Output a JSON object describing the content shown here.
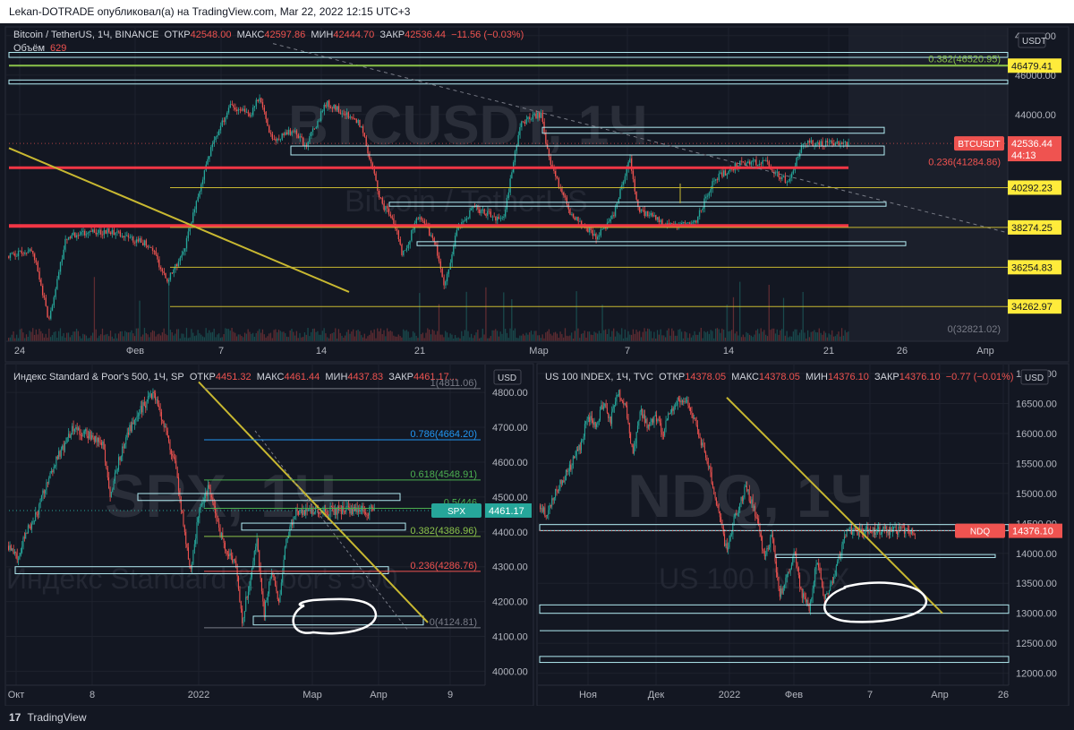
{
  "header": {
    "publish_line": "Lekan-DOTRADE опубликовал(а) на TradingView.com, Mar 22, 2022 12:15 UTC+3"
  },
  "footer": {
    "logo_mark": "17",
    "logo_text": "TradingView"
  },
  "colors": {
    "background": "#131722",
    "up": "#26a69a",
    "down": "#ef5350",
    "yellow": "#c8b831",
    "cyan": "#b2ebf2",
    "green_line": "#8bc34a",
    "red_line": "#f23645",
    "fib_blue": "#2196f3",
    "fib_green": "#4caf50"
  },
  "chart_data": [
    {
      "id": "btc",
      "type": "candlestick",
      "legend": {
        "symbol": "Bitcoin / TetherUS, 1Ч, BINANCE",
        "o_label": "ОТКР",
        "o": "42548.00",
        "h_label": "МАКС",
        "h": "42597.86",
        "l_label": "МИН",
        "l": "42444.70",
        "c_label": "ЗАКР",
        "c": "42536.44",
        "change": "−11.56 (−0.03%)",
        "volume_label": "Объём",
        "volume": "629"
      },
      "watermark": {
        "main": "BTCUSDT, 1Ч",
        "sub": "Bitcoin / TetherUS"
      },
      "currency": "USDT",
      "y_ticks": [
        48000,
        46000,
        44000
      ],
      "x_ticks": [
        "24",
        "Фев",
        "7",
        "14",
        "21",
        "Мар",
        "7",
        "14",
        "21",
        "26",
        "Апр"
      ],
      "ylim": [
        32500,
        48400
      ],
      "price_path": [
        [
          0,
          36800
        ],
        [
          0.03,
          37200
        ],
        [
          0.05,
          33500
        ],
        [
          0.07,
          37800
        ],
        [
          0.12,
          38100
        ],
        [
          0.17,
          37400
        ],
        [
          0.19,
          35500
        ],
        [
          0.21,
          37000
        ],
        [
          0.24,
          42000
        ],
        [
          0.265,
          44500
        ],
        [
          0.29,
          44000
        ],
        [
          0.3,
          45000
        ],
        [
          0.315,
          42600
        ],
        [
          0.34,
          43200
        ],
        [
          0.355,
          42400
        ],
        [
          0.38,
          44600
        ],
        [
          0.42,
          43500
        ],
        [
          0.445,
          39500
        ],
        [
          0.46,
          38600
        ],
        [
          0.47,
          36800
        ],
        [
          0.49,
          39000
        ],
        [
          0.51,
          37300
        ],
        [
          0.52,
          35200
        ],
        [
          0.535,
          38200
        ],
        [
          0.555,
          39300
        ],
        [
          0.59,
          38600
        ],
        [
          0.61,
          43600
        ],
        [
          0.635,
          44000
        ],
        [
          0.645,
          41500
        ],
        [
          0.67,
          39000
        ],
        [
          0.7,
          37800
        ],
        [
          0.72,
          38800
        ],
        [
          0.74,
          41700
        ],
        [
          0.75,
          39200
        ],
        [
          0.79,
          38300
        ],
        [
          0.82,
          38700
        ],
        [
          0.84,
          40700
        ],
        [
          0.87,
          41500
        ],
        [
          0.9,
          41600
        ],
        [
          0.92,
          40800
        ],
        [
          0.93,
          40600
        ],
        [
          0.945,
          42536
        ]
      ],
      "last_price": {
        "label": "BTCUSDT",
        "value": "42536.44",
        "countdown": "44:13",
        "price": 42536.44
      },
      "levels": [
        {
          "name": "level-46479",
          "price": 46479.41,
          "label": "46479.41",
          "tag_bg": "#ffeb3b",
          "color": "#8bc34a",
          "width": 2
        },
        {
          "name": "level-40292",
          "price": 40292.23,
          "label": "40292.23",
          "tag_bg": "#ffeb3b",
          "color": "#c8b831",
          "width": 1
        },
        {
          "name": "level-38274",
          "price": 38274.25,
          "label": "38274.25",
          "tag_bg": "#ffeb3b",
          "color": "#c8b831",
          "width": 1
        },
        {
          "name": "level-36254",
          "price": 36254.83,
          "label": "36254.83",
          "tag_bg": "#ffeb3b",
          "color": "#c8b831",
          "width": 1
        },
        {
          "name": "level-34262",
          "price": 34262.97,
          "label": "34262.97",
          "tag_bg": "#ffeb3b",
          "color": "#c8b831",
          "width": 1
        }
      ],
      "fib_labels": [
        {
          "text": "0.382(46520.95)",
          "price": 46520.95,
          "color": "#8bc34a"
        },
        {
          "text": "0.236(41284.86)",
          "price": 41284.86,
          "color": "#ef5350"
        },
        {
          "text": "0(32821.02)",
          "price": 32821.02,
          "color": "#787b86"
        }
      ]
    },
    {
      "id": "spx",
      "type": "candlestick",
      "legend": {
        "symbol": "Индекс Standard & Poor's 500, 1Ч, SP",
        "o_label": "ОТКР",
        "o": "4451.32",
        "h_label": "МАКС",
        "h": "4461.44",
        "l_label": "МИН",
        "l": "4437.83",
        "c_label": "ЗАКР",
        "c": "4461.17..."
      },
      "watermark": {
        "main": "SPX, 1Ч",
        "sub": "Индекс Standard & Poor's 500"
      },
      "currency": "USD",
      "y_ticks": [
        4800,
        4700,
        4600,
        4500,
        4400,
        4300,
        4200,
        4100,
        4000
      ],
      "x_ticks": [
        "Окт",
        "8",
        "2022",
        "Мар",
        "Апр",
        "9"
      ],
      "ylim": [
        3960,
        4880
      ],
      "price_path": [
        [
          0,
          4360
        ],
        [
          0.03,
          4320
        ],
        [
          0.05,
          4400
        ],
        [
          0.08,
          4450
        ],
        [
          0.11,
          4550
        ],
        [
          0.14,
          4620
        ],
        [
          0.18,
          4700
        ],
        [
          0.22,
          4680
        ],
        [
          0.26,
          4650
        ],
        [
          0.28,
          4500
        ],
        [
          0.3,
          4590
        ],
        [
          0.33,
          4690
        ],
        [
          0.37,
          4760
        ],
        [
          0.4,
          4800
        ],
        [
          0.43,
          4700
        ],
        [
          0.46,
          4580
        ],
        [
          0.48,
          4420
        ],
        [
          0.5,
          4280
        ],
        [
          0.52,
          4450
        ],
        [
          0.55,
          4530
        ],
        [
          0.58,
          4400
        ],
        [
          0.6,
          4330
        ],
        [
          0.62,
          4320
        ],
        [
          0.64,
          4150
        ],
        [
          0.66,
          4250
        ],
        [
          0.68,
          4380
        ],
        [
          0.7,
          4170
        ],
        [
          0.72,
          4290
        ],
        [
          0.74,
          4190
        ],
        [
          0.76,
          4380
        ],
        [
          0.79,
          4461
        ]
      ],
      "last_price": {
        "label": "SPX",
        "value": "4461.17",
        "price": 4461.17
      },
      "fib_labels": [
        {
          "text": "1(4811.06)",
          "price": 4811.06,
          "color": "#787b86"
        },
        {
          "text": "0.786(4664.20)",
          "price": 4664.2,
          "color": "#2196f3"
        },
        {
          "text": "0.618(4548.91)",
          "price": 4548.91,
          "color": "#4caf50"
        },
        {
          "text": "0.5(446",
          "price": 4467.49,
          "color": "#4caf50"
        },
        {
          "text": "0.382(4386.96)",
          "price": 4386.96,
          "color": "#8bc34a"
        },
        {
          "text": "0.236(4286.76)",
          "price": 4286.76,
          "color": "#ef5350"
        },
        {
          "text": "0(4124.81)",
          "price": 4124.81,
          "color": "#787b86"
        }
      ]
    },
    {
      "id": "ndq",
      "type": "candlestick",
      "legend": {
        "symbol": "US 100 INDEX, 1Ч, TVC",
        "o_label": "ОТКР",
        "o": "14378.05",
        "h_label": "МАКС",
        "h": "14378.05",
        "l_label": "МИН",
        "l": "14376.10",
        "c_label": "ЗАКР",
        "c": "14376.10",
        "change": "−0.77 (−0.01%)"
      },
      "watermark": {
        "main": "NDQ, 1Ч",
        "sub": "US 100 INDEX"
      },
      "currency": "USD",
      "y_ticks": [
        17000,
        16500,
        16000,
        15500,
        15000,
        14500,
        14000,
        13500,
        13000,
        12500,
        12000
      ],
      "x_ticks": [
        "Ноя",
        "Дек",
        "2022",
        "Фев",
        "7",
        "Апр",
        "26"
      ],
      "ylim": [
        11800,
        17150
      ],
      "price_path": [
        [
          0,
          14800
        ],
        [
          0.02,
          14650
        ],
        [
          0.05,
          15100
        ],
        [
          0.08,
          15400
        ],
        [
          0.11,
          15800
        ],
        [
          0.13,
          16300
        ],
        [
          0.15,
          16100
        ],
        [
          0.17,
          16500
        ],
        [
          0.19,
          16200
        ],
        [
          0.21,
          16700
        ],
        [
          0.23,
          16500
        ],
        [
          0.25,
          15600
        ],
        [
          0.27,
          16400
        ],
        [
          0.29,
          16100
        ],
        [
          0.31,
          16300
        ],
        [
          0.33,
          16000
        ],
        [
          0.35,
          16400
        ],
        [
          0.37,
          16550
        ],
        [
          0.4,
          16500
        ],
        [
          0.42,
          16100
        ],
        [
          0.45,
          15500
        ],
        [
          0.48,
          14600
        ],
        [
          0.5,
          14000
        ],
        [
          0.52,
          14600
        ],
        [
          0.55,
          15100
        ],
        [
          0.58,
          14600
        ],
        [
          0.6,
          13900
        ],
        [
          0.62,
          14300
        ],
        [
          0.64,
          13300
        ],
        [
          0.66,
          13600
        ],
        [
          0.68,
          14000
        ],
        [
          0.7,
          13300
        ],
        [
          0.72,
          13100
        ],
        [
          0.74,
          13900
        ],
        [
          0.76,
          13200
        ],
        [
          0.78,
          13500
        ],
        [
          0.8,
          14000
        ],
        [
          0.82,
          14376
        ]
      ],
      "last_price": {
        "label": "NDQ",
        "value": "14376.10",
        "price": 14376.1
      }
    }
  ]
}
